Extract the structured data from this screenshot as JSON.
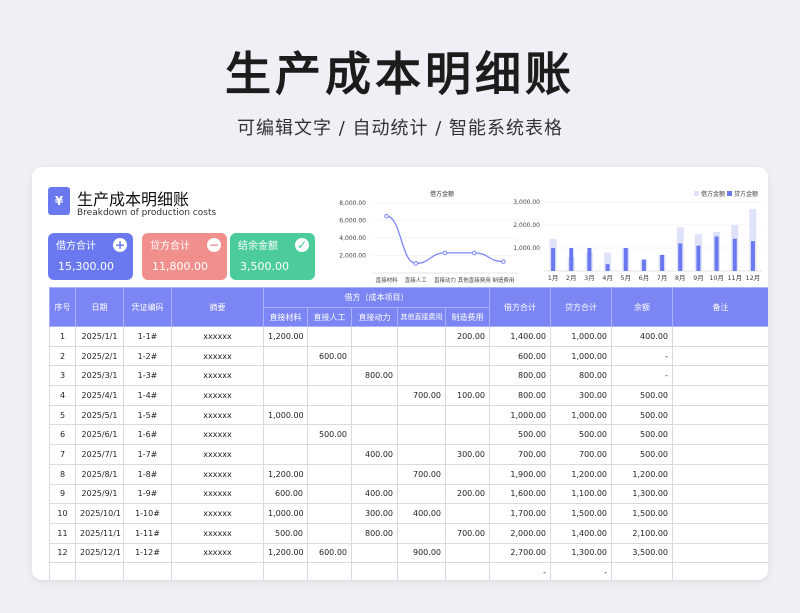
{
  "page": {
    "title": "生产成本明细账",
    "subtitle": "可编辑文字 / 自动统计 / 智能系统表格"
  },
  "doc": {
    "icon": "yen-document-icon",
    "title": "生产成本明细账",
    "subtitle": "Breakdown of production costs"
  },
  "stats": [
    {
      "label": "借方合计",
      "value": "15,300.00",
      "badge": "+"
    },
    {
      "label": "贷方合计",
      "value": "11,800.00",
      "badge": "−"
    },
    {
      "label": "结余金额",
      "value": "3,500.00",
      "badge": "✓"
    }
  ],
  "colors": {
    "accent": "#7b86f4",
    "debit": "#6a79f0",
    "credit": "#f18f8d",
    "balance": "#4ccb9b"
  },
  "chart_data": [
    {
      "type": "line",
      "title": "借方金额",
      "categories": [
        "直接材料",
        "直接人工",
        "直接动力",
        "其他直接费用",
        "制造费用"
      ],
      "values": [
        6500,
        1100,
        2300,
        2300,
        1300
      ],
      "ylim": [
        0,
        8000
      ],
      "yticks": [
        "8,000.00",
        "6,000.00",
        "4,000.00",
        "2,000.00"
      ],
      "grid": true
    },
    {
      "type": "bar",
      "categories": [
        "1月",
        "2月",
        "3月",
        "4月",
        "5月",
        "6月",
        "7月",
        "8月",
        "9月",
        "10月",
        "11月",
        "12月"
      ],
      "series": [
        {
          "name": "借方金额",
          "values": [
            1400,
            600,
            800,
            800,
            1000,
            500,
            700,
            1900,
            1600,
            1700,
            2000,
            2700
          ]
        },
        {
          "name": "贷方金额",
          "values": [
            1000,
            1000,
            1000,
            300,
            1000,
            500,
            700,
            1200,
            1100,
            1500,
            1400,
            1300
          ]
        }
      ],
      "ylim": [
        0,
        3000
      ],
      "yticks": [
        "3,000.00",
        "2,000.00",
        "1,000.00"
      ],
      "legend": "top-right"
    }
  ],
  "table": {
    "headers": {
      "seq": "序号",
      "date": "日期",
      "voucher": "凭证编码",
      "summary": "摘要",
      "debit_group": "借方（成本项目）",
      "debit_total": "借方合计",
      "credit_total": "贷方合计",
      "balance": "余额",
      "note": "备注"
    },
    "subheaders": [
      "直接材料",
      "直接人工",
      "直接动力",
      "其他直接费用",
      "制造费用"
    ],
    "rows": [
      [
        "1",
        "2025/1/1",
        "1-1#",
        "xxxxxx",
        "1,200.00",
        "",
        "",
        "",
        "200.00",
        "1,400.00",
        "1,000.00",
        "400.00",
        ""
      ],
      [
        "2",
        "2025/2/1",
        "1-2#",
        "xxxxxx",
        "",
        "600.00",
        "",
        "",
        "",
        "600.00",
        "1,000.00",
        "-",
        ""
      ],
      [
        "3",
        "2025/3/1",
        "1-3#",
        "xxxxxx",
        "",
        "",
        "800.00",
        "",
        "",
        "800.00",
        "800.00",
        "-",
        ""
      ],
      [
        "4",
        "2025/4/1",
        "1-4#",
        "xxxxxx",
        "",
        "",
        "",
        "700.00",
        "100.00",
        "800.00",
        "300.00",
        "500.00",
        ""
      ],
      [
        "5",
        "2025/5/1",
        "1-5#",
        "xxxxxx",
        "1,000.00",
        "",
        "",
        "",
        "",
        "1,000.00",
        "1,000.00",
        "500.00",
        ""
      ],
      [
        "6",
        "2025/6/1",
        "1-6#",
        "xxxxxx",
        "",
        "500.00",
        "",
        "",
        "",
        "500.00",
        "500.00",
        "500.00",
        ""
      ],
      [
        "7",
        "2025/7/1",
        "1-7#",
        "xxxxxx",
        "",
        "",
        "400.00",
        "",
        "300.00",
        "700.00",
        "700.00",
        "500.00",
        ""
      ],
      [
        "8",
        "2025/8/1",
        "1-8#",
        "xxxxxx",
        "1,200.00",
        "",
        "",
        "700.00",
        "",
        "1,900.00",
        "1,200.00",
        "1,200.00",
        ""
      ],
      [
        "9",
        "2025/9/1",
        "1-9#",
        "xxxxxx",
        "600.00",
        "",
        "400.00",
        "",
        "200.00",
        "1,600.00",
        "1,100.00",
        "1,300.00",
        ""
      ],
      [
        "10",
        "2025/10/1",
        "1-10#",
        "xxxxxx",
        "1,000.00",
        "",
        "300.00",
        "400.00",
        "",
        "1,700.00",
        "1,500.00",
        "1,500.00",
        ""
      ],
      [
        "11",
        "2025/11/1",
        "1-11#",
        "xxxxxx",
        "500.00",
        "",
        "800.00",
        "",
        "700.00",
        "2,000.00",
        "1,400.00",
        "2,100.00",
        ""
      ],
      [
        "12",
        "2025/12/1",
        "1-12#",
        "xxxxxx",
        "1,200.00",
        "600.00",
        "",
        "900.00",
        "",
        "2,700.00",
        "1,300.00",
        "3,500.00",
        ""
      ],
      [
        "",
        "",
        "",
        "",
        "",
        "",
        "",
        "",
        "",
        "-",
        "-",
        "",
        ""
      ]
    ]
  }
}
